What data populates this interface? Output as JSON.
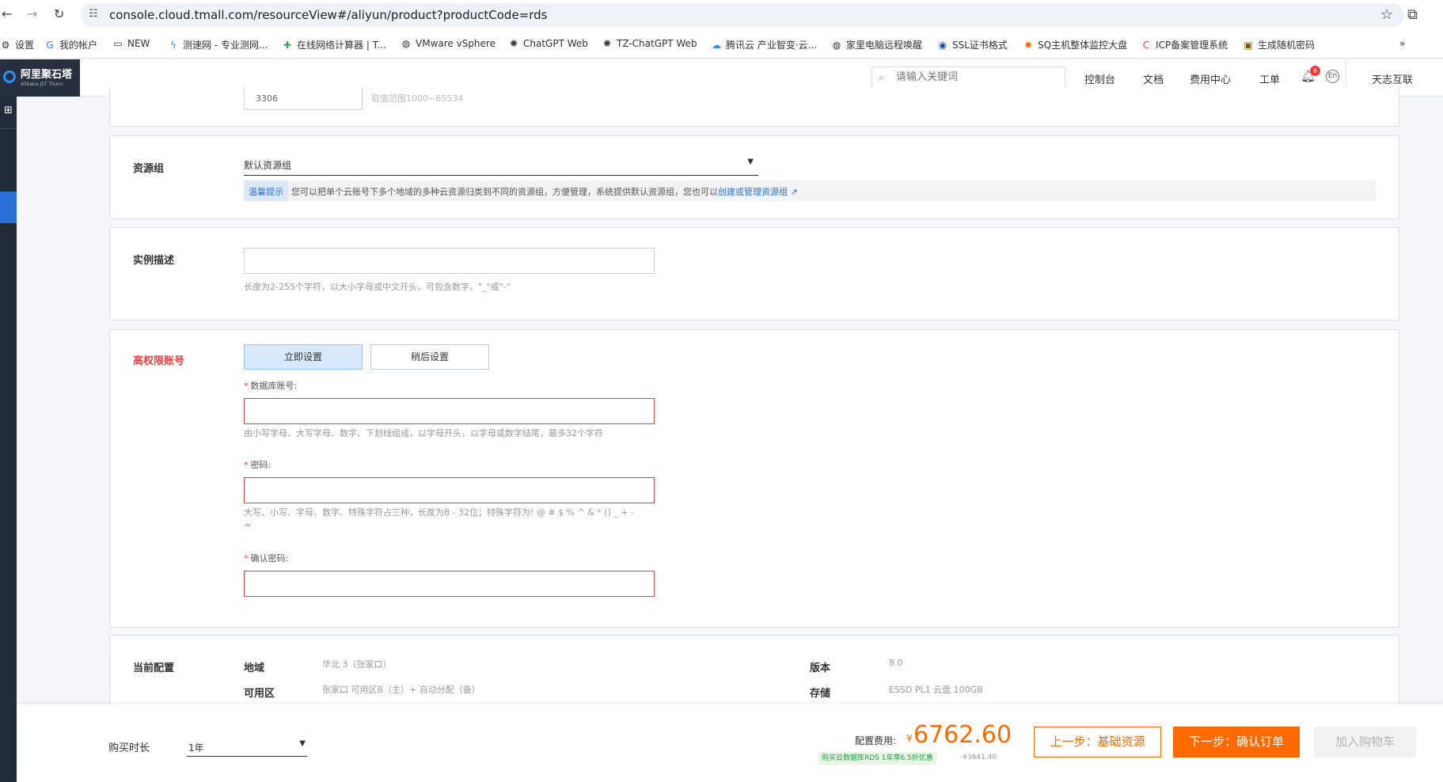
{
  "browser": {
    "url": "console.cloud.tmall.com/resourceView#/aliyun/product?productCode=rds",
    "bookmarks": [
      "设置",
      "我的帐户",
      "NEW",
      "测速网 - 专业测网...",
      "在线网络计算器 | T...",
      "VMware vSphere",
      "ChatGPT Web",
      "TZ-ChatGPT Web",
      "腾讯云 产业智变·云...",
      "家里电脑远程唤醒",
      "SSL证书格式",
      "SQ主机整体监控大盘",
      "ICP备案管理系统",
      "生成随机密码"
    ]
  },
  "topbar": {
    "logo_title": "阿里聚石塔",
    "logo_sub": "Alibaba JST Titans",
    "search_placeholder": "请输入关键词",
    "nav": [
      "控制台",
      "文档",
      "费用中心",
      "工单"
    ],
    "notifications": "6",
    "lang": "En",
    "user": "天志互联"
  },
  "port_card": {
    "port_value": "3306",
    "range_hint": "取值范围1000~65534"
  },
  "resource_group": {
    "label": "资源组",
    "value": "默认资源组",
    "tip_tag": "温馨提示",
    "tip_text": "您可以把单个云账号下多个地域的多种云资源归类到不同的资源组，方便管理，系统提供默认资源组，您也可以",
    "tip_link": "创建或管理资源组"
  },
  "description": {
    "label": "实例描述",
    "value": "",
    "hint": "长度为2-255个字符，以大小字母或中文开头，可包含数字，\"_\"或\"-\""
  },
  "admin_account": {
    "label": "高权限账号",
    "tab_now": "立即设置",
    "tab_later": "稍后设置",
    "account_label": "数据库账号:",
    "account_hint": "由小写字母、大写字母、数字、下划线组成，以字母开头，以字母或数字结尾，最多32个字符",
    "password_label": "密码:",
    "password_hint_1": "大写、小写、字母、数字、特殊字符占三种，长度为8 - 32位；特殊字符为! @ # $ % ^ & * () _ + -",
    "password_hint_2": "=",
    "confirm_label": "确认密码:"
  },
  "current_config": {
    "label": "当前配置",
    "region_key": "地域",
    "region_val": "华北 3（张家口）",
    "zone_key": "可用区",
    "zone_val": "张家口 可用区B（主）+ 自动分配（备）",
    "version_key": "版本",
    "version_val": "8.0",
    "storage_key": "存储",
    "storage_val": "ESSD PL1 云盘 100GB"
  },
  "footer": {
    "duration_label": "购买时长",
    "duration_value": "1年",
    "fee_label": "配置费用:",
    "currency": "¥",
    "fee_value": "6762.60",
    "promo": "购买云数据库RDS 1年享6.5折优惠",
    "promo_amount": "-¥3641.40",
    "prev_button": "上一步：基础资源",
    "next_button": "下一步：确认订单",
    "cart_button": "加入购物车"
  },
  "colors": {
    "accent_orange": "#ff6a00",
    "link_blue": "#2b72d1",
    "error_red": "#e54545",
    "sidebar": "#222b38"
  }
}
